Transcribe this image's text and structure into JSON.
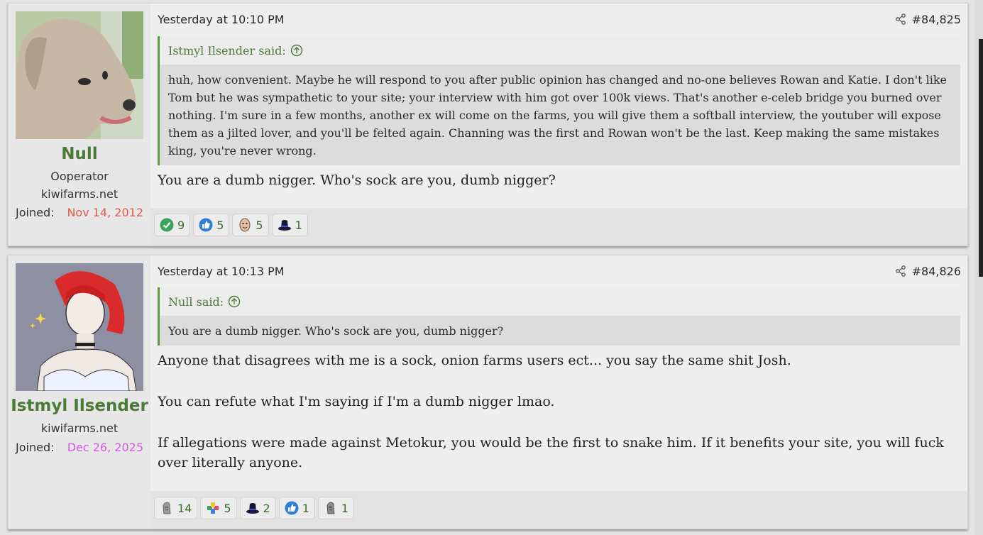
{
  "posts": [
    {
      "author": "Null",
      "user_title": "Ooperator",
      "user_site": "kiwifarms.net",
      "joined_label": "Joined:",
      "joined_date": "Nov 14, 2012",
      "joined_color": "#e05a4a",
      "timestamp": "Yesterday at 10:10 PM",
      "post_number": "#84,825",
      "quote": {
        "author_said": "Istmyl Ilsender said:",
        "text": "huh, how convenient. Maybe he will respond to you after public opinion has changed and no-one believes Rowan and Katie. I don't like Tom but he was sympathetic to your site; your interview with him got over 100k views. That's another e-celeb bridge you burned over nothing. I'm sure in a few months, another ex will come on the farms, you will give them a softball interview, the youtuber will expose them as a jilted lover, and you'll be felted again. Channing was the first and Rowan won't be the last. Keep making the same mistakes king, you're never wrong."
      },
      "paragraphs": [
        "You are a dumb nigger. Who's sock are you, dumb nigger?"
      ],
      "reactions": [
        {
          "icon": "check-icon",
          "count": "9"
        },
        {
          "icon": "thumbs-up-icon",
          "count": "5"
        },
        {
          "icon": "face-icon",
          "count": "5"
        },
        {
          "icon": "top-hat-icon",
          "count": "1"
        }
      ]
    },
    {
      "author": "Istmyl Ilsender",
      "user_site": "kiwifarms.net",
      "joined_label": "Joined:",
      "joined_date": "Dec 26, 2025",
      "joined_color": "#d35be0",
      "timestamp": "Yesterday at 10:13 PM",
      "post_number": "#84,826",
      "quote": {
        "author_said": "Null said:",
        "text": "You are a dumb nigger. Who's sock are you, dumb nigger?"
      },
      "paragraphs": [
        "Anyone that disagrees with me is a sock, onion farms users ect... you say the same shit Josh.",
        "You can refute what I'm saying if I'm a dumb nigger lmao.",
        "If allegations were made against Metokur, you would be the first to snake him. If it benefits your site, you will fuck over literally anyone."
      ],
      "reactions": [
        {
          "icon": "moai-icon",
          "count": "14"
        },
        {
          "icon": "puzzle-icon",
          "count": "5"
        },
        {
          "icon": "top-hat-icon",
          "count": "2"
        },
        {
          "icon": "thumbs-up-icon",
          "count": "1"
        },
        {
          "icon": "moai-icon",
          "count": "1"
        }
      ]
    }
  ],
  "colors": {
    "username": "#4b7a36",
    "quote_border": "#5a9a3a"
  }
}
